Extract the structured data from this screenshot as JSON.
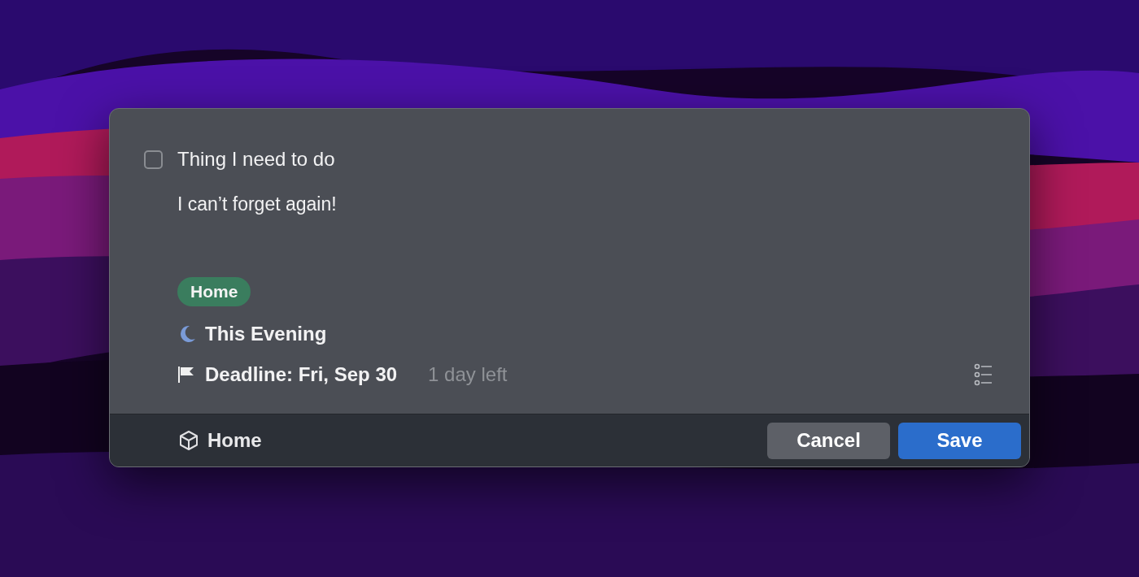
{
  "todo": {
    "checked": false,
    "title": "Thing I need to do",
    "notes": "I can’t forget again!"
  },
  "tags": [
    {
      "label": "Home",
      "color": "#3a7d5e"
    }
  ],
  "when": {
    "kind": "evening",
    "label": "This Evening"
  },
  "deadline": {
    "label": "Deadline: Fri, Sep 30",
    "remaining": "1 day left"
  },
  "footer": {
    "area": "Home"
  },
  "buttons": [
    {
      "label": "Cancel",
      "kind": "secondary"
    },
    {
      "label": "Save",
      "kind": "primary"
    }
  ]
}
